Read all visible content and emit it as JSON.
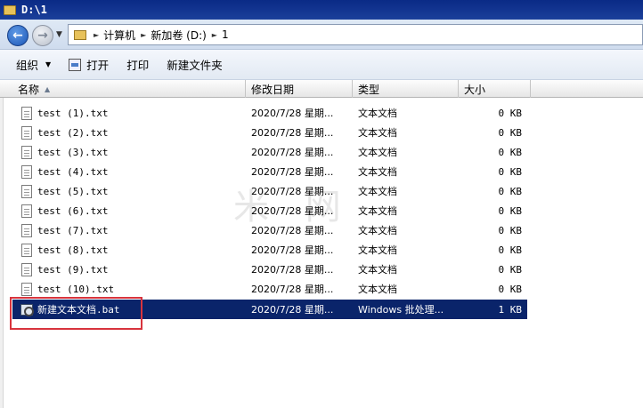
{
  "window": {
    "title": "D:\\1"
  },
  "address": {
    "segments": [
      "计算机",
      "新加卷 (D:)",
      "1"
    ]
  },
  "toolbar": {
    "organize_label": "组织",
    "open_label": "打开",
    "print_label": "打印",
    "new_folder_label": "新建文件夹"
  },
  "columns": {
    "name": "名称",
    "date": "修改日期",
    "type": "类型",
    "size": "大小"
  },
  "files": [
    {
      "name": "test (1).txt",
      "date": "2020/7/28 星期...",
      "type": "文本文档",
      "size": "0 KB",
      "icon": "text-file-icon"
    },
    {
      "name": "test (2).txt",
      "date": "2020/7/28 星期...",
      "type": "文本文档",
      "size": "0 KB",
      "icon": "text-file-icon"
    },
    {
      "name": "test (3).txt",
      "date": "2020/7/28 星期...",
      "type": "文本文档",
      "size": "0 KB",
      "icon": "text-file-icon"
    },
    {
      "name": "test (4).txt",
      "date": "2020/7/28 星期...",
      "type": "文本文档",
      "size": "0 KB",
      "icon": "text-file-icon"
    },
    {
      "name": "test (5).txt",
      "date": "2020/7/28 星期...",
      "type": "文本文档",
      "size": "0 KB",
      "icon": "text-file-icon"
    },
    {
      "name": "test (6).txt",
      "date": "2020/7/28 星期...",
      "type": "文本文档",
      "size": "0 KB",
      "icon": "text-file-icon"
    },
    {
      "name": "test (7).txt",
      "date": "2020/7/28 星期...",
      "type": "文本文档",
      "size": "0 KB",
      "icon": "text-file-icon"
    },
    {
      "name": "test (8).txt",
      "date": "2020/7/28 星期...",
      "type": "文本文档",
      "size": "0 KB",
      "icon": "text-file-icon"
    },
    {
      "name": "test (9).txt",
      "date": "2020/7/28 星期...",
      "type": "文本文档",
      "size": "0 KB",
      "icon": "text-file-icon"
    },
    {
      "name": "test (10).txt",
      "date": "2020/7/28 星期...",
      "type": "文本文档",
      "size": "0 KB",
      "icon": "text-file-icon"
    },
    {
      "name": "新建文本文档.bat",
      "date": "2020/7/28 星期...",
      "type": "Windows 批处理...",
      "size": "1 KB",
      "icon": "batch-file-icon",
      "selected": true
    }
  ],
  "watermark": "米 网",
  "colors": {
    "selection": "#0a246a",
    "highlight_box": "#d8343d",
    "titlebar": "#0a2a86"
  }
}
